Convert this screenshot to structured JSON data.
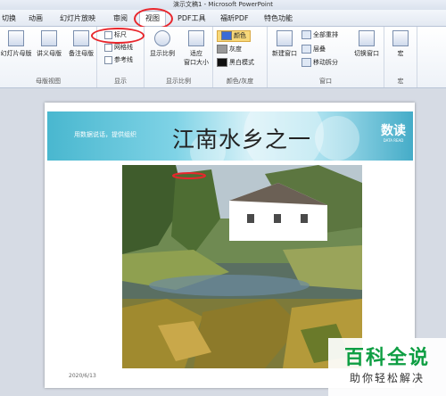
{
  "window": {
    "title": "演示文稿1 - Microsoft PowerPoint"
  },
  "tabs": [
    "切换",
    "动画",
    "幻灯片放映",
    "审阅",
    "视图",
    "PDF工具",
    "福昕PDF",
    "特色功能"
  ],
  "active_tab": "视图",
  "ribbon": {
    "master_views": {
      "slide_master": "幻灯片母版",
      "handout_master": "讲义母版",
      "notes_master": "备注母版",
      "label": "母版视图"
    },
    "show": {
      "ruler": "标尺",
      "gridlines": "网格线",
      "guides": "参考线",
      "label": "显示"
    },
    "zoom": {
      "zoom": "显示比例",
      "fit_line1": "适应",
      "fit_line2": "窗口大小",
      "label": "显示比例"
    },
    "color": {
      "color": "颜色",
      "grayscale": "灰度",
      "bw": "黑白模式",
      "label": "颜色/灰度"
    },
    "window": {
      "new_window": "新建窗口",
      "arrange_all": "全部重排",
      "cascade": "层叠",
      "move_split": "移动拆分",
      "switch_window": "切换窗口",
      "label": "窗口"
    },
    "macros": {
      "macros": "宏",
      "label": "宏"
    }
  },
  "slide": {
    "banner_text": "用数据说话，提供组织",
    "title": "江南水乡之一",
    "logo_main": "数读",
    "logo_sub": "DATA READ",
    "date": "2020/6/13"
  },
  "watermark": {
    "line1": "百科全说",
    "line2": "助你轻松解决"
  },
  "colors": {
    "accent_red": "#e8262c",
    "watermark_green": "#0e9e43",
    "banner_teal": "#49b7cf"
  }
}
